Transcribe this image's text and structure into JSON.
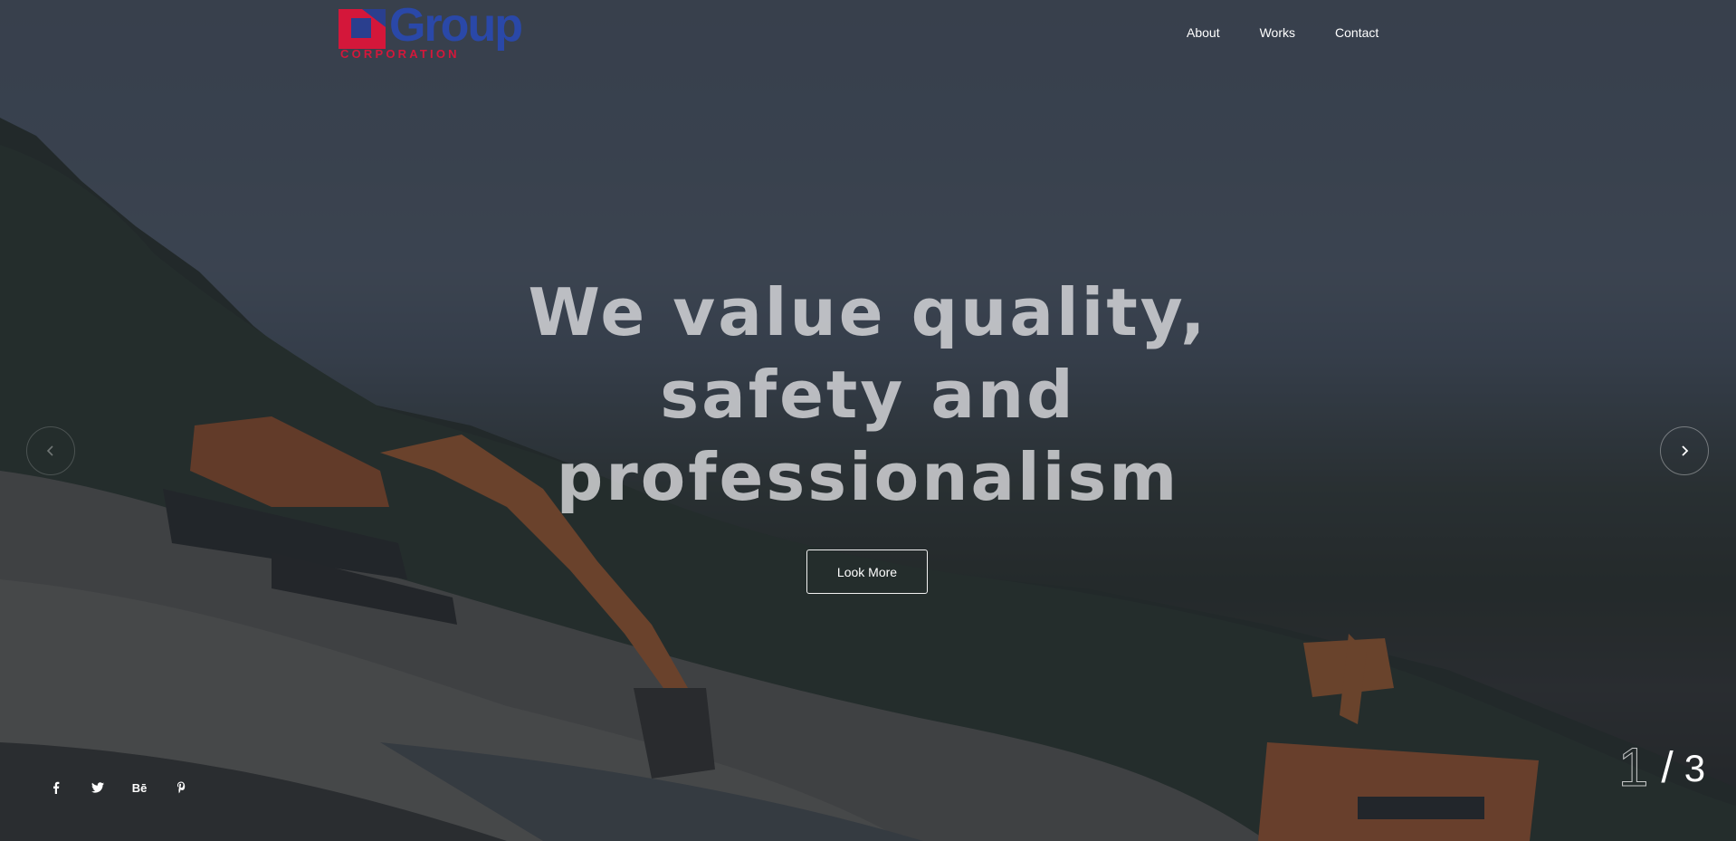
{
  "brand": {
    "name": "Group",
    "tagline": "CORPORATION"
  },
  "nav": {
    "items": [
      "About",
      "Works",
      "Contact"
    ]
  },
  "hero": {
    "headline_lines": [
      "We value quality,",
      "safety and",
      "professionalism"
    ],
    "cta_label": "Look More"
  },
  "slider": {
    "current": "1",
    "separator": "/",
    "total": "3",
    "prev_icon": "chevron-left-icon",
    "next_icon": "chevron-right-icon"
  },
  "social": {
    "behance_label": "Bē",
    "icons": [
      "facebook-icon",
      "twitter-icon",
      "behance-icon",
      "pinterest-icon"
    ]
  },
  "colors": {
    "brand_red": "#d4173a",
    "brand_blue": "#2a48a8",
    "overlay": "#1c222e"
  }
}
